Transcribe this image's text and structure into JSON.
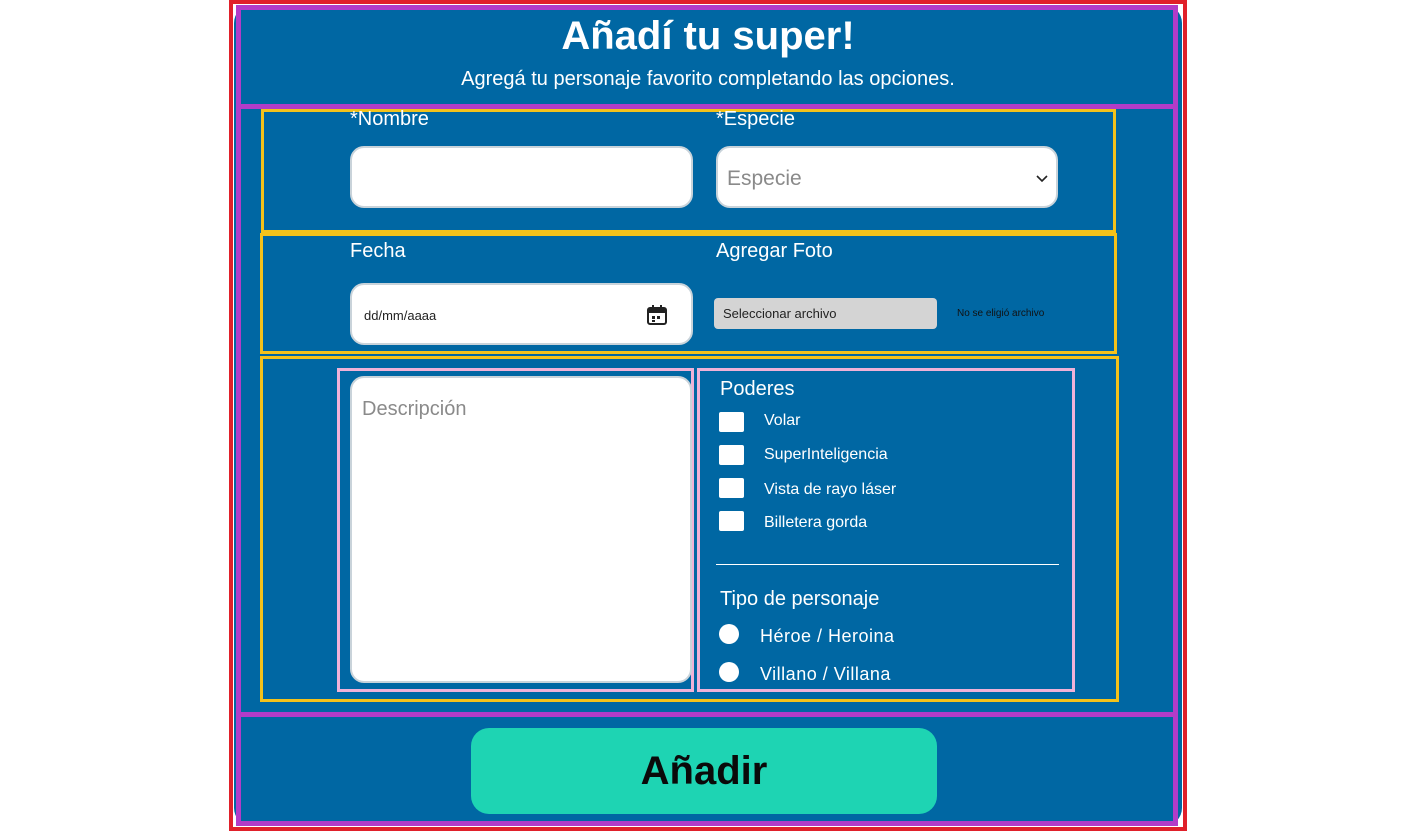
{
  "header": {
    "title": "Añadí tu super!",
    "subtitle": "Agregá tu personaje favorito completando las opciones."
  },
  "form": {
    "nombre": {
      "label": "*Nombre",
      "value": ""
    },
    "especie": {
      "label": "*Especie",
      "selected": "Especie"
    },
    "fecha": {
      "label": "Fecha",
      "placeholder": "dd/mm/aaaa"
    },
    "foto": {
      "label": "Agregar Foto",
      "button": "Seleccionar archivo",
      "status": "No se eligió archivo"
    },
    "descripcion": {
      "placeholder": "Descripción"
    },
    "poderes": {
      "label": "Poderes",
      "options": [
        "Volar",
        "SuperInteligencia",
        "Vista de rayo láser",
        "Billetera gorda"
      ]
    },
    "tipo": {
      "label": "Tipo de personaje",
      "options": [
        "Héroe / Heroina",
        "Villano / Villana"
      ]
    },
    "submit_label": "Añadir"
  },
  "colors": {
    "background": "#0067a3",
    "accent": "#1ed4b3",
    "outer_border": "#e0202a",
    "section_border": "#b23cc8",
    "row_border": "#f3c21b",
    "column_border": "#f0b2d8"
  }
}
